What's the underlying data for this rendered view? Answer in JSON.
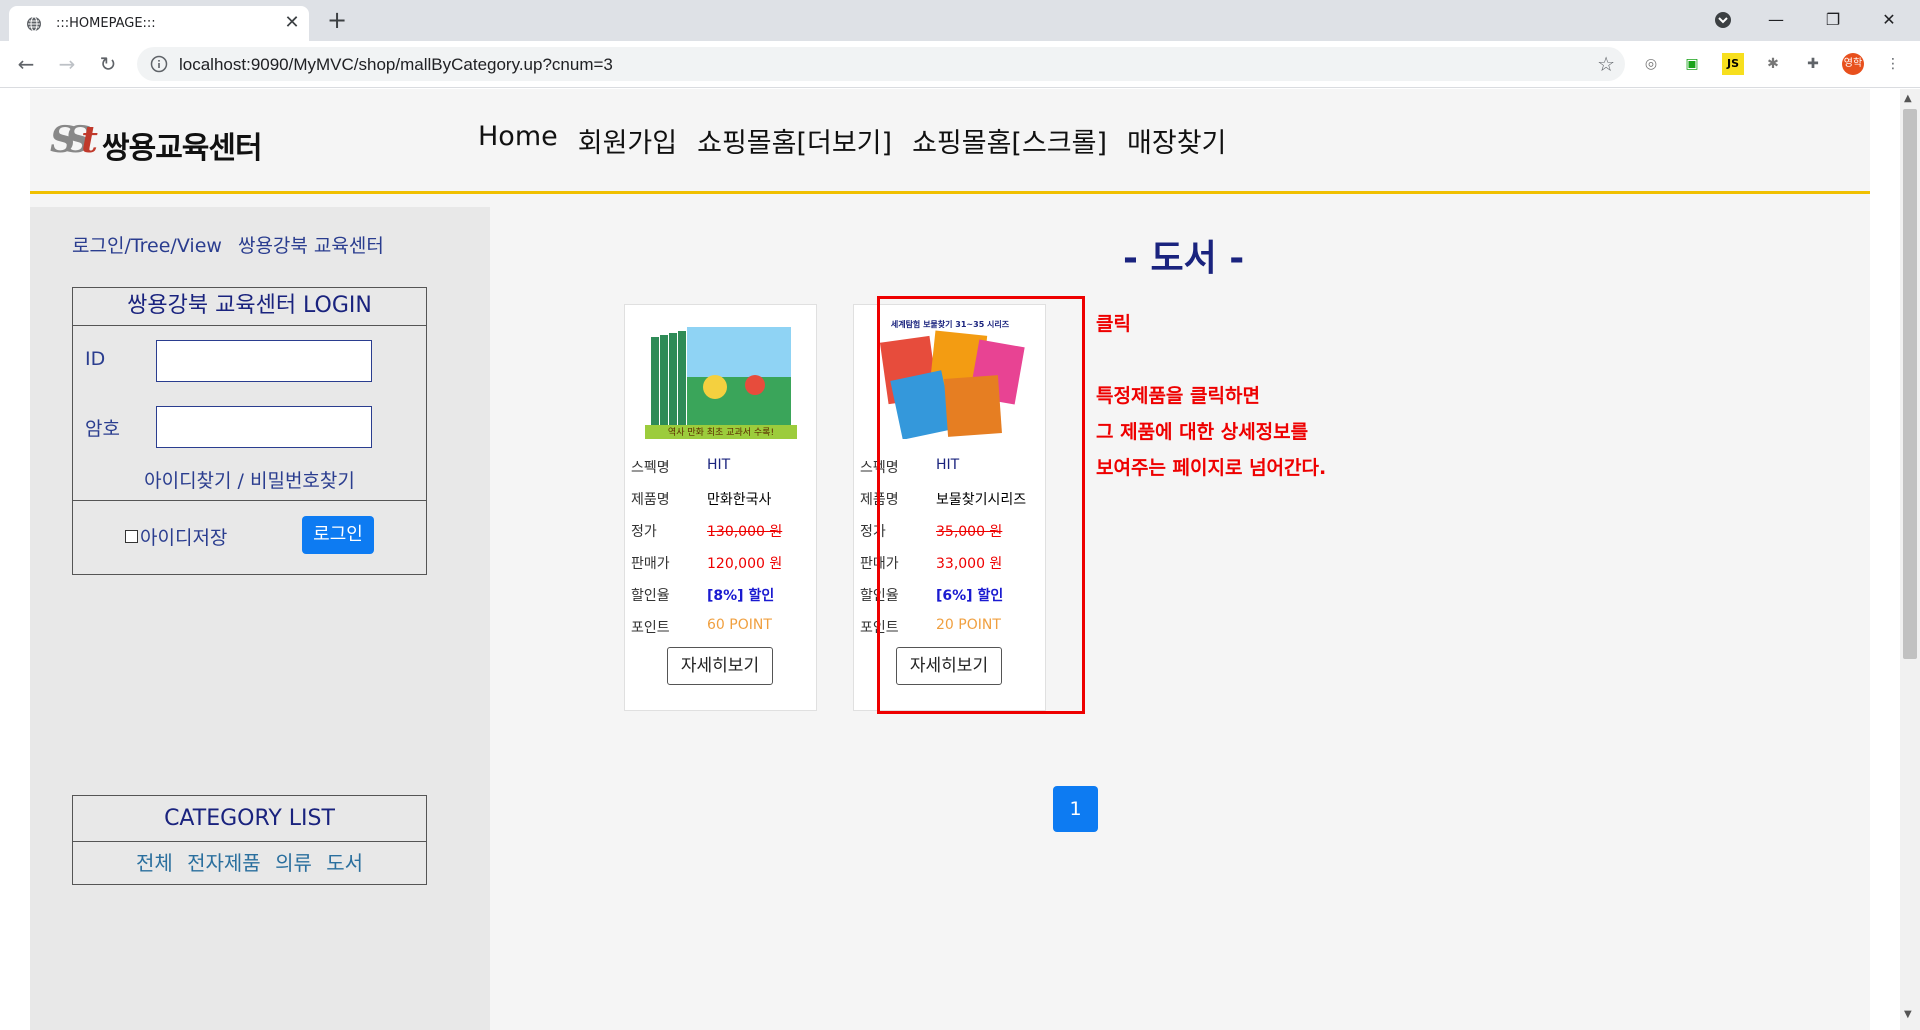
{
  "browser": {
    "tab_title": ":::HOMEPAGE:::",
    "tab_close": "✕",
    "new_tab": "+",
    "url": "localhost:9090/MyMVC/shop/mallByCategory.up?cnum=3",
    "profile_initial": "영학",
    "window": {
      "minimize": "—",
      "restore": "❐",
      "close": "✕"
    },
    "ext_js": "JS"
  },
  "header": {
    "logo_mark": "SS",
    "logo_mark_t": "t",
    "logo_text": "쌍용교육센터",
    "nav": [
      "Home",
      "회원가입",
      "쇼핑몰홈[더보기]",
      "쇼핑몰홈[스크롤]",
      "매장찾기"
    ]
  },
  "sidebar": {
    "links": [
      "로그인/Tree/View",
      "쌍용강북 교육센터"
    ],
    "login": {
      "title": "쌍용강북 교육센터 LOGIN",
      "id_label": "ID",
      "pw_label": "암호",
      "find": "아이디찾기 / 비밀번호찾기",
      "save_id": "아이디저장",
      "login_button": "로그인"
    },
    "category": {
      "title": "CATEGORY LIST",
      "items": [
        "전체",
        "전자제품",
        "의류",
        "도서"
      ]
    }
  },
  "main": {
    "title": "- 도서 -",
    "products": [
      {
        "spec_label": "스펙명",
        "spec": "HIT",
        "name_label": "제품명",
        "name": "만화한국사",
        "price_label": "정가",
        "price": "130,000 원",
        "sale_label": "판매가",
        "sale": "120,000 원",
        "rate_label": "할인율",
        "rate": "[8%] 할인",
        "point_label": "포인트",
        "point": "60 POINT",
        "detail": "자세히보기",
        "img_caption": "역사 만화 최초 교과서 수록!"
      },
      {
        "spec_label": "스펙명",
        "spec": "HIT",
        "name_label": "제품명",
        "name": "보물찾기시리즈",
        "price_label": "정가",
        "price": "35,000 원",
        "sale_label": "판매가",
        "sale": "33,000 원",
        "rate_label": "할인율",
        "rate": "[6%] 할인",
        "point_label": "포인트",
        "point": "20 POINT",
        "detail": "자세히보기",
        "img_caption": "세계탐험 보물찾기 31~35 시리즈"
      }
    ],
    "annotation": [
      "클릭",
      "특정제품을 클릭하면",
      "그 제품에 대한 상세정보를",
      "보여주는 페이지로 넘어간다."
    ],
    "pager": "1"
  },
  "colors": {
    "accent": "#0d7bf2",
    "header_line": "#f0c000",
    "discount_red": "#e00000",
    "point_orange": "#f0a040",
    "navy": "#1a237e"
  }
}
